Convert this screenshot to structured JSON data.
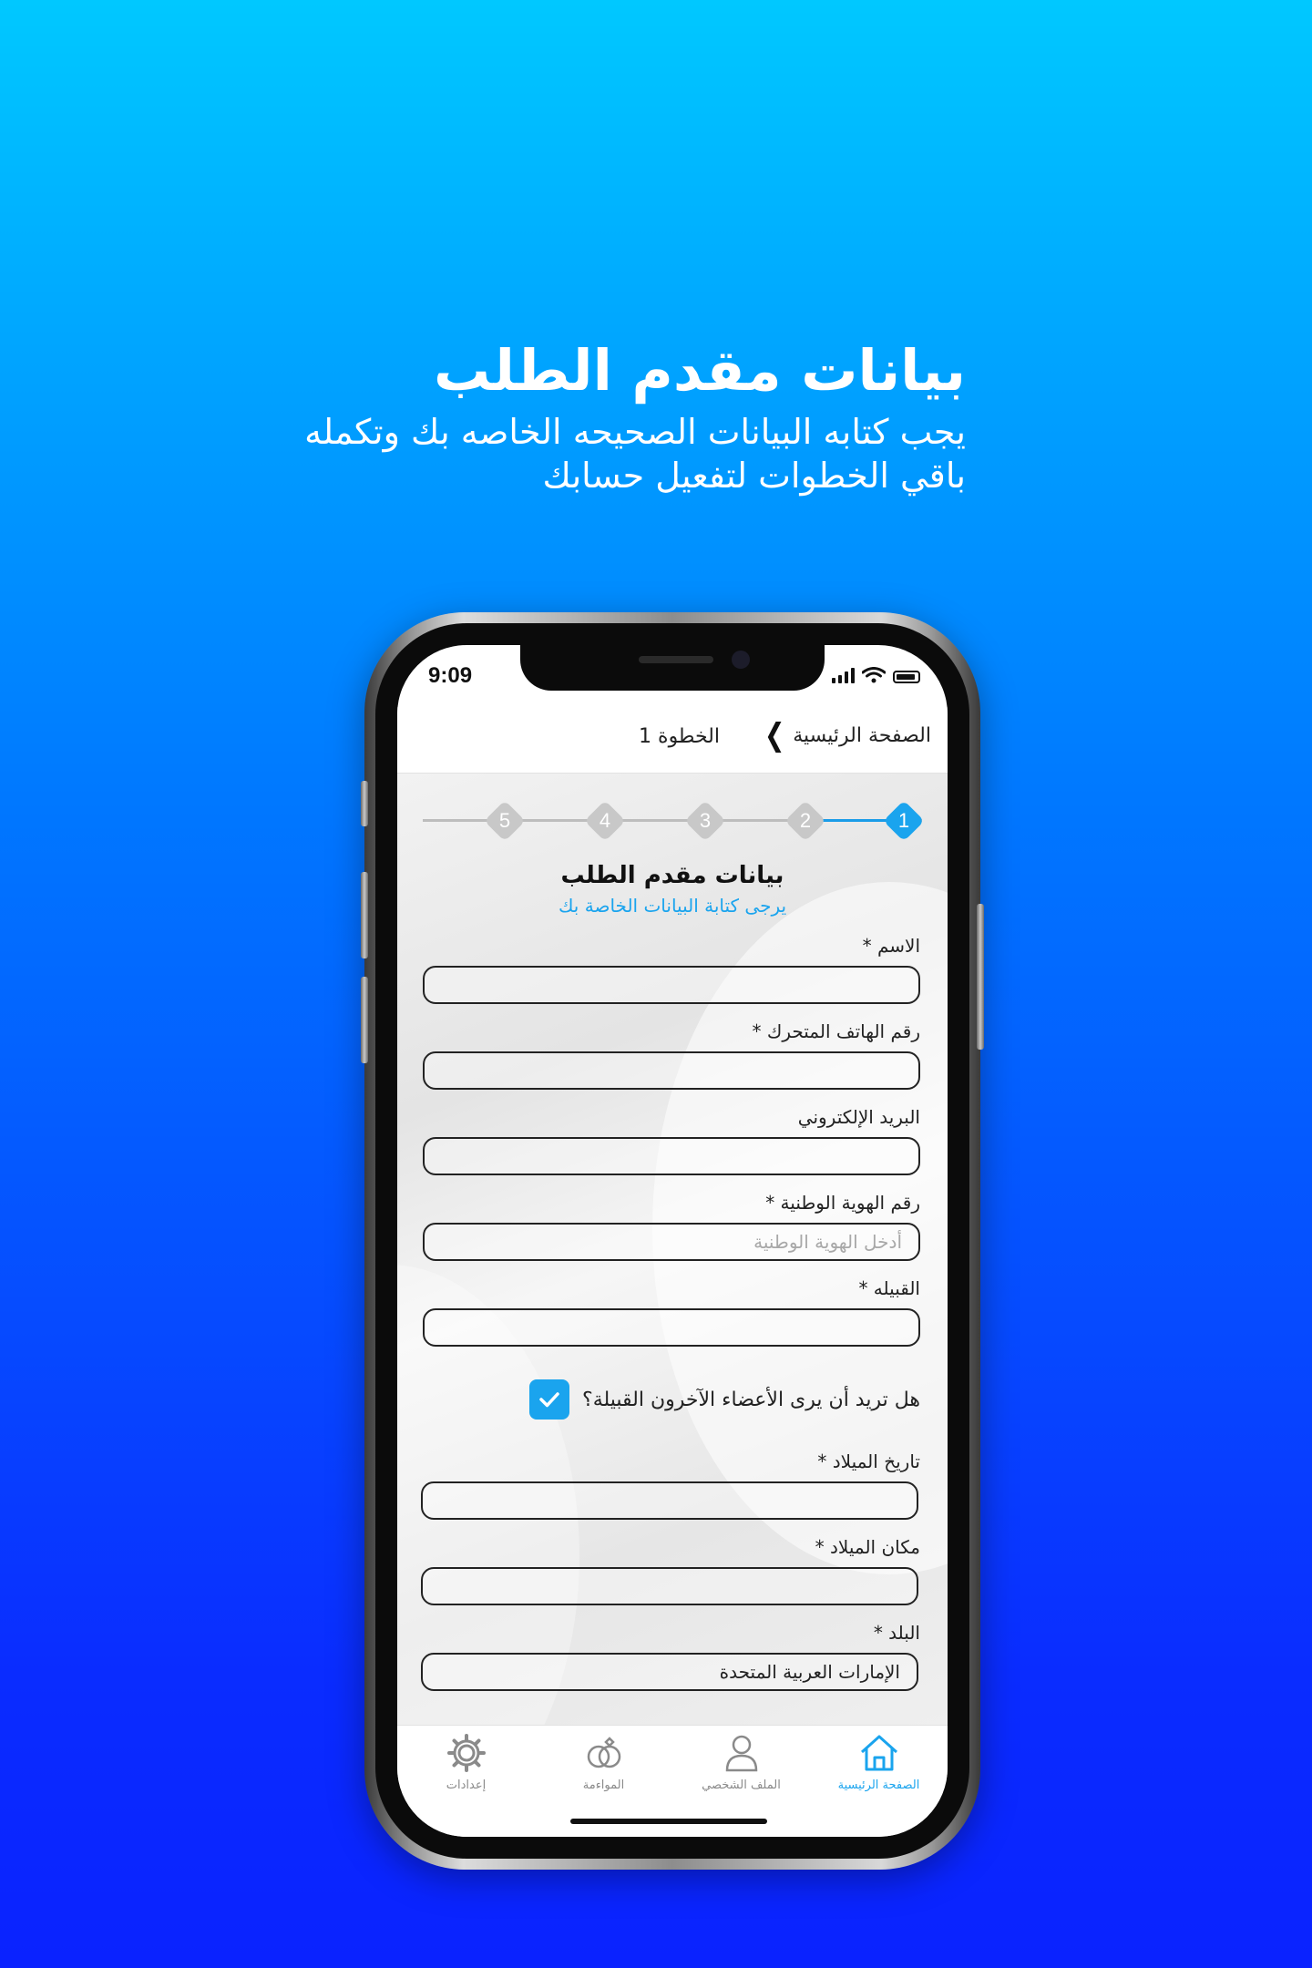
{
  "hero": {
    "title": "بيانات مقدم الطلب",
    "subtitle": "يجب كتابه البيانات الصحيحه الخاصه بك وتكمله باقي الخطوات لتفعيل حسابك"
  },
  "status_bar": {
    "time": "9:09"
  },
  "topbar": {
    "back_label": "الصفحة الرئيسية",
    "step_label": "الخطوة 1"
  },
  "stepper": {
    "steps": [
      "1",
      "2",
      "3",
      "4",
      "5"
    ],
    "active_step": 1
  },
  "form": {
    "title": "بيانات مقدم الطلب",
    "subtitle": "يرجى كتابة البيانات الخاصة بك",
    "fields": [
      {
        "label": "الاسم *",
        "value": "",
        "placeholder": ""
      },
      {
        "label": "رقم الهاتف المتحرك *",
        "value": "",
        "placeholder": ""
      },
      {
        "label": "البريد الإلكتروني",
        "value": "",
        "placeholder": ""
      },
      {
        "label": "رقم الهوية الوطنية *",
        "value": "",
        "placeholder": "أدخل الهوية الوطنية"
      },
      {
        "label": "القبيله *",
        "value": "",
        "placeholder": ""
      },
      {
        "label": "تاريخ الميلاد *",
        "value": "",
        "placeholder": ""
      },
      {
        "label": "مكان الميلاد *",
        "value": "",
        "placeholder": ""
      },
      {
        "label": "البلد *",
        "value": "الإمارات العربية المتحدة",
        "placeholder": ""
      }
    ],
    "checkbox": {
      "label": "هل تريد أن يرى الأعضاء الآخرون القبيلة؟",
      "checked": true
    }
  },
  "tabbar": {
    "tabs": [
      {
        "label": "الصفحة الرئيسية",
        "icon": "home-icon",
        "active": true
      },
      {
        "label": "الملف الشخصي",
        "icon": "profile-icon",
        "active": false
      },
      {
        "label": "المواءمة",
        "icon": "rings-icon",
        "active": false
      },
      {
        "label": "إعدادات",
        "icon": "gear-icon",
        "active": false
      }
    ]
  },
  "colors": {
    "accent": "#1aa4ee",
    "bg_top": "#00c8ff",
    "bg_bottom": "#0a22ff"
  }
}
